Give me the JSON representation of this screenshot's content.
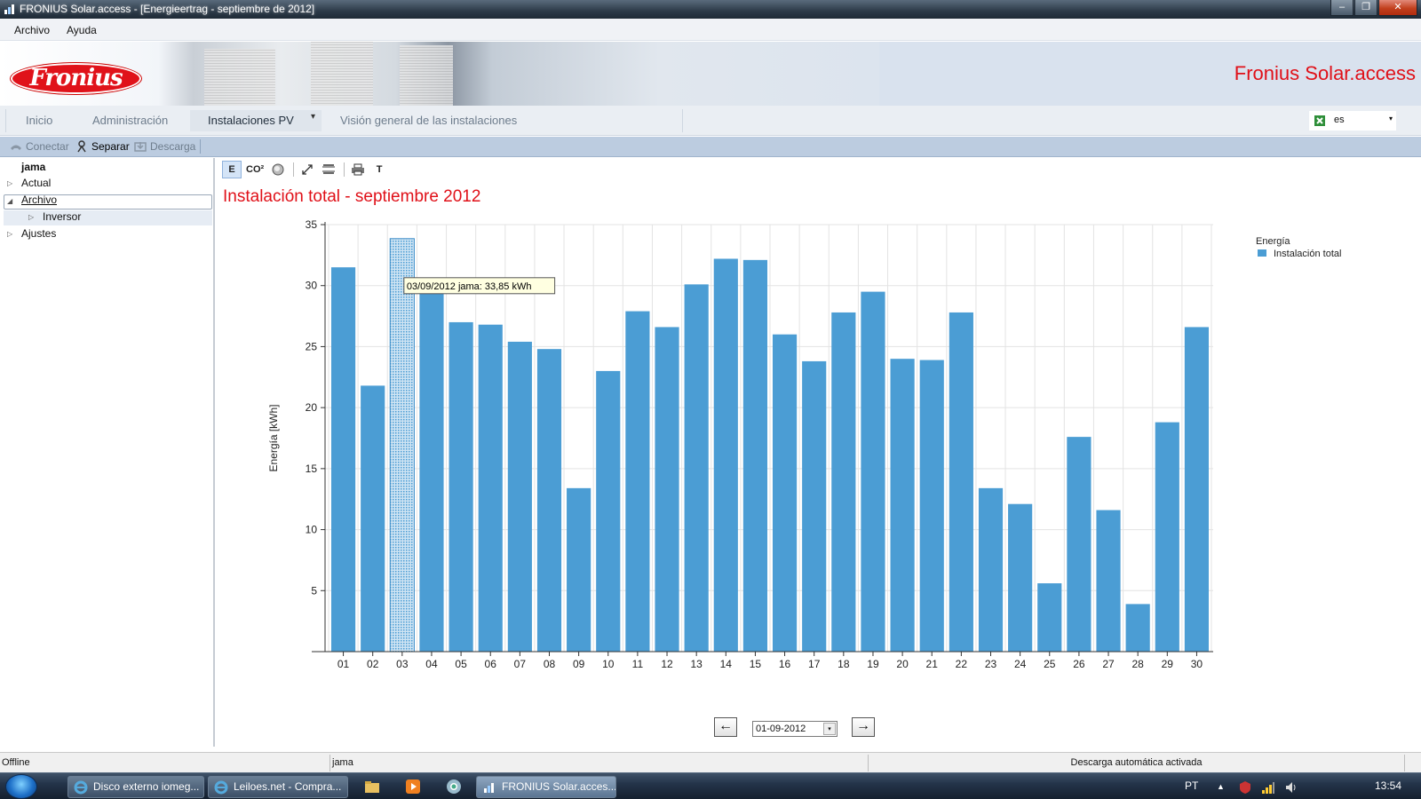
{
  "window": {
    "title": "FRONIUS Solar.access - [Energieertrag - septiembre de 2012]",
    "controls": [
      "–",
      "❐",
      "✕"
    ]
  },
  "menu": {
    "items": [
      "Archivo",
      "Ayuda"
    ]
  },
  "banner": {
    "logo_text": "Fronius",
    "brand": "Fronius Solar.access"
  },
  "nav": {
    "tabs": [
      "Inicio",
      "Administración",
      "Instalaciones PV",
      "Visión general de las instalaciones"
    ],
    "dropdown_arrow": "▾"
  },
  "language": {
    "value": "es",
    "arrow": "▾"
  },
  "toolbar": {
    "connect": "Conectar",
    "separate": "Separar",
    "download": "Descarga"
  },
  "tree": {
    "root": "jama",
    "items": [
      {
        "label": "Actual",
        "expander": "▷"
      },
      {
        "label": "Archivo",
        "expander": "◢"
      },
      {
        "label": "Inversor",
        "expander": "▷"
      },
      {
        "label": "Ajustes",
        "expander": "▷"
      }
    ]
  },
  "chart_toolbar": {
    "energy": "E",
    "co2": "CO²",
    "text": "T"
  },
  "chart_title": "Instalación total - septiembre 2012",
  "tooltip": "03/09/2012 jama: 33,85 kWh",
  "chart_data": {
    "type": "bar",
    "title": "Instalación total - septiembre 2012",
    "xlabel": "",
    "ylabel": "Energía [kWh]",
    "ylim": [
      0,
      35
    ],
    "yticks": [
      5,
      10,
      15,
      20,
      25,
      30,
      35
    ],
    "grid": true,
    "legend": {
      "title": "Energía",
      "placement": "top-right"
    },
    "highlight_index": 2,
    "categories": [
      "01",
      "02",
      "03",
      "04",
      "05",
      "06",
      "07",
      "08",
      "09",
      "10",
      "11",
      "12",
      "13",
      "14",
      "15",
      "16",
      "17",
      "18",
      "19",
      "20",
      "21",
      "22",
      "23",
      "24",
      "25",
      "26",
      "27",
      "28",
      "29",
      "30"
    ],
    "series": [
      {
        "name": "Instalación total",
        "color": "#4b9dd4",
        "values": [
          31.5,
          21.8,
          33.85,
          29.6,
          27.0,
          26.8,
          25.4,
          24.8,
          13.4,
          23.0,
          27.9,
          26.6,
          30.1,
          32.2,
          32.1,
          26.0,
          23.8,
          27.8,
          29.5,
          24.0,
          23.9,
          27.8,
          13.4,
          12.1,
          5.6,
          17.6,
          11.6,
          3.9,
          18.8,
          26.6
        ]
      }
    ]
  },
  "date_nav": {
    "prev": "←",
    "date": "01-09-2012",
    "dropdown": "▾",
    "next": "→"
  },
  "status": {
    "state": "Offline",
    "plant": "jama",
    "download": "Descarga automática activada"
  },
  "taskbar": {
    "tasks": [
      "Disco externo iomeg...",
      "Leiloes.net - Compra...",
      "FRONIUS Solar.acces..."
    ],
    "lang": "PT",
    "tray_arrow": "▲",
    "clock": "13:54"
  }
}
